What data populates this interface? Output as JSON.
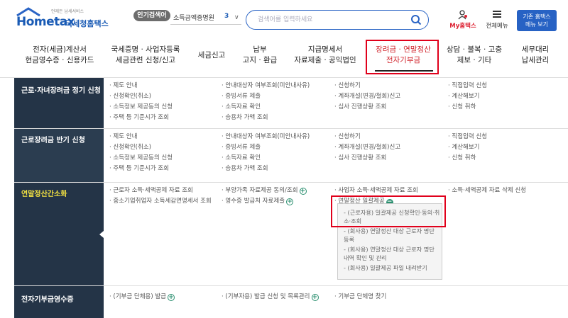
{
  "header": {
    "logo_tag": "언제든 납세서비스",
    "logo_main": "Hometax",
    "logo_sub": "국세청홈택스",
    "popular_label": "인기검색어",
    "keyword": "소득금액증명원",
    "keyword_rank": "3",
    "search_placeholder": "검색어를 입력하세요",
    "mytax_label": "My홈택스",
    "allmenu_label": "전체메뉴",
    "basic_btn_line1": "기존 홈택스",
    "basic_btn_line2": "메뉴 보기"
  },
  "gnb": [
    {
      "l1": "전자(세금)계산서",
      "l2": "현금영수증 · 신용카드"
    },
    {
      "l1": "국세증명 · 사업자등록",
      "l2": "세금관련 신청/신고"
    },
    {
      "l1": "세금신고",
      "l2": ""
    },
    {
      "l1": "납부",
      "l2": "고지 · 환급"
    },
    {
      "l1": "지급명세서",
      "l2": "자료제출 · 공익법인"
    },
    {
      "l1": "장려금 · 연말정산",
      "l2": "전자기부금"
    },
    {
      "l1": "상담 · 불복 · 고충",
      "l2": "제보 · 기타"
    },
    {
      "l1": "세무대리",
      "l2": "납세관리"
    }
  ],
  "rows": [
    {
      "head": "근로·자녀장려금 정기 신청",
      "cols": [
        [
          "· 제도 안내",
          "· 신청확인(취소)",
          "· 소득정보 제공동의 신청",
          "· 주택 등 기준시가 조회"
        ],
        [
          "· 안내대상자 여부조회(미안내사유)",
          "· 증빙서류 제출",
          "· 소득자료 확인",
          "· 승용차 가액 조회"
        ],
        [
          "· 신청하기",
          "· 계좌개설(변경/철회)신고",
          "· 심사 진행상황 조회"
        ],
        [
          "· 직접입력 신청",
          "· 계산해보기",
          "· 신청 취하"
        ]
      ]
    },
    {
      "head": "근로장려금 반기 신청",
      "cols": [
        [
          "· 제도 안내",
          "· 신청확인(취소)",
          "· 소득정보 제공동의 신청",
          "· 주택 등 기준시가 조회"
        ],
        [
          "· 안내대상자 여부조회(미안내사유)",
          "· 증빙서류 제출",
          "· 소득자료 확인",
          "· 승용차 가액 조회"
        ],
        [
          "· 신청하기",
          "· 계좌개설(변경/철회)신고",
          "· 심사 진행상황 조회"
        ],
        [
          "· 직접입력 신청",
          "· 계산해보기",
          "· 신청 취하"
        ]
      ]
    },
    {
      "head": "연말정산간소화",
      "cols": [
        [
          "· 근로자 소득·세액공제 자료 조회",
          "· 중소기업취업자 소득세감면명세서 조회"
        ],
        [
          "· 부양가족 자료제공 동의/조회",
          "· 영수증 발급처 자료제출"
        ],
        [
          "· 사업자 소득·세액공제 자료 조회",
          "· 연말정산 일괄제공"
        ],
        [
          "· 소득·세액공제 자료 삭제 신청"
        ]
      ],
      "submenu": [
        "- (근로자용) 일괄제공 신청확인·동의·취",
        "  소·조회",
        "- (회사용) 연말정산 대상 근로자 명단",
        "  등록",
        "- (회사용) 연말정산 대상 근로자 명단",
        "  내역 확인 및 관리",
        "- (회사용) 일괄제공 파일 내려받기"
      ]
    },
    {
      "head": "전자기부금영수증",
      "cols": [
        [
          "· (기부금 단체용) 발급"
        ],
        [
          "· (기부자용) 발급 신청 및 목록관리"
        ],
        [
          "· 기부금 단체명 찾기"
        ]
      ]
    }
  ],
  "colors": {
    "brand": "#1a5bb5",
    "row_head_bg": "#243447",
    "highlight_red": "#e0001b",
    "active_text": "#d0232b"
  }
}
